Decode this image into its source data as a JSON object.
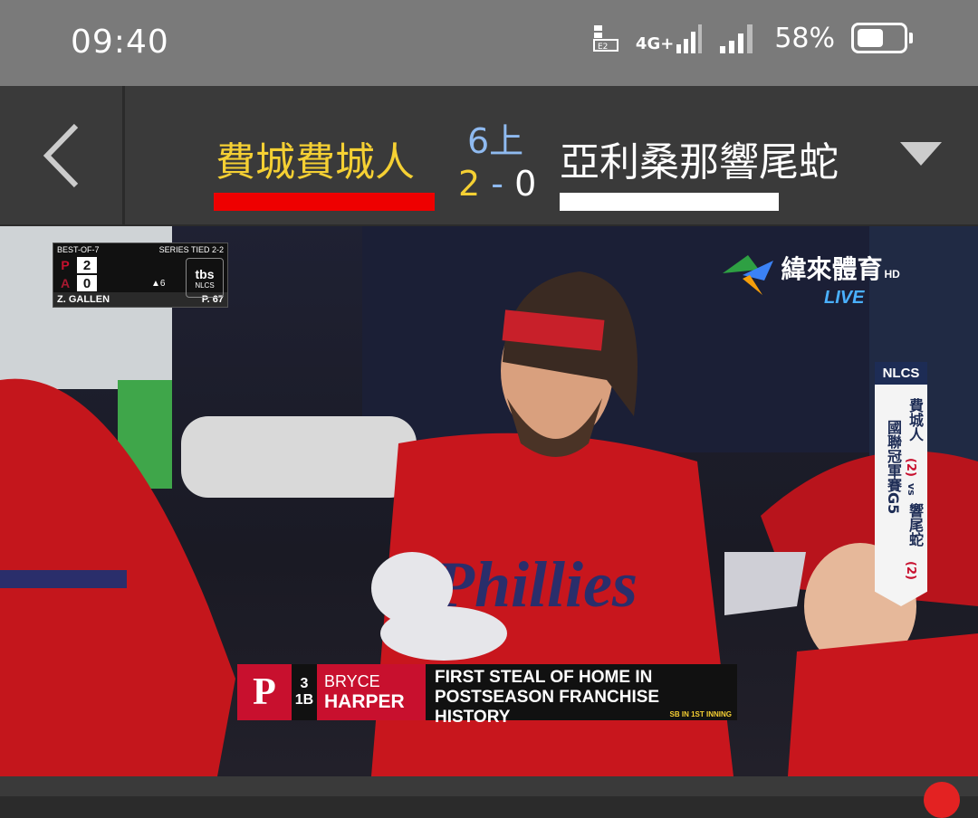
{
  "status_bar": {
    "time": "09:40",
    "network": "4G+",
    "battery_percent": "58%",
    "battery_level": 0.58
  },
  "header": {
    "home_team": "費城費城人",
    "away_team": "亞利桑那響尾蛇",
    "inning": "6上",
    "home_score": "2",
    "separator": "-",
    "away_score": "0",
    "home_color": "#ee0000",
    "away_color": "#ffffff"
  },
  "video": {
    "scorebug": {
      "series_format": "BEST-OF-7",
      "series_status": "SERIES TIED 2-2",
      "home_logo": "P",
      "home_runs": "2",
      "away_logo": "A",
      "away_runs": "0",
      "outs_label": "▲6",
      "network_logo": "tbs",
      "network_sub": "NLCS",
      "pitcher": "Z. GALLEN",
      "pitch_count": "P. 67"
    },
    "broadcaster": {
      "name": "緯來體育",
      "hd": "HD",
      "live": "LIVE"
    },
    "nlcs_tag": {
      "header": "NLCS",
      "left_col": "國聯冠軍賽G5",
      "team1": "費城人",
      "team1_wins": "(2)",
      "vs": "vs",
      "team2": "響尾蛇",
      "team2_wins": "(2)"
    },
    "lower_third": {
      "logo": "P",
      "number": "3",
      "position": "1B",
      "first_name": "BRYCE",
      "last_name": "HARPER",
      "line1": "FIRST STEAL OF HOME IN",
      "line2": "POSTSEASON FRANCHISE HISTORY",
      "subline": "SB IN 1ST INNING"
    }
  }
}
